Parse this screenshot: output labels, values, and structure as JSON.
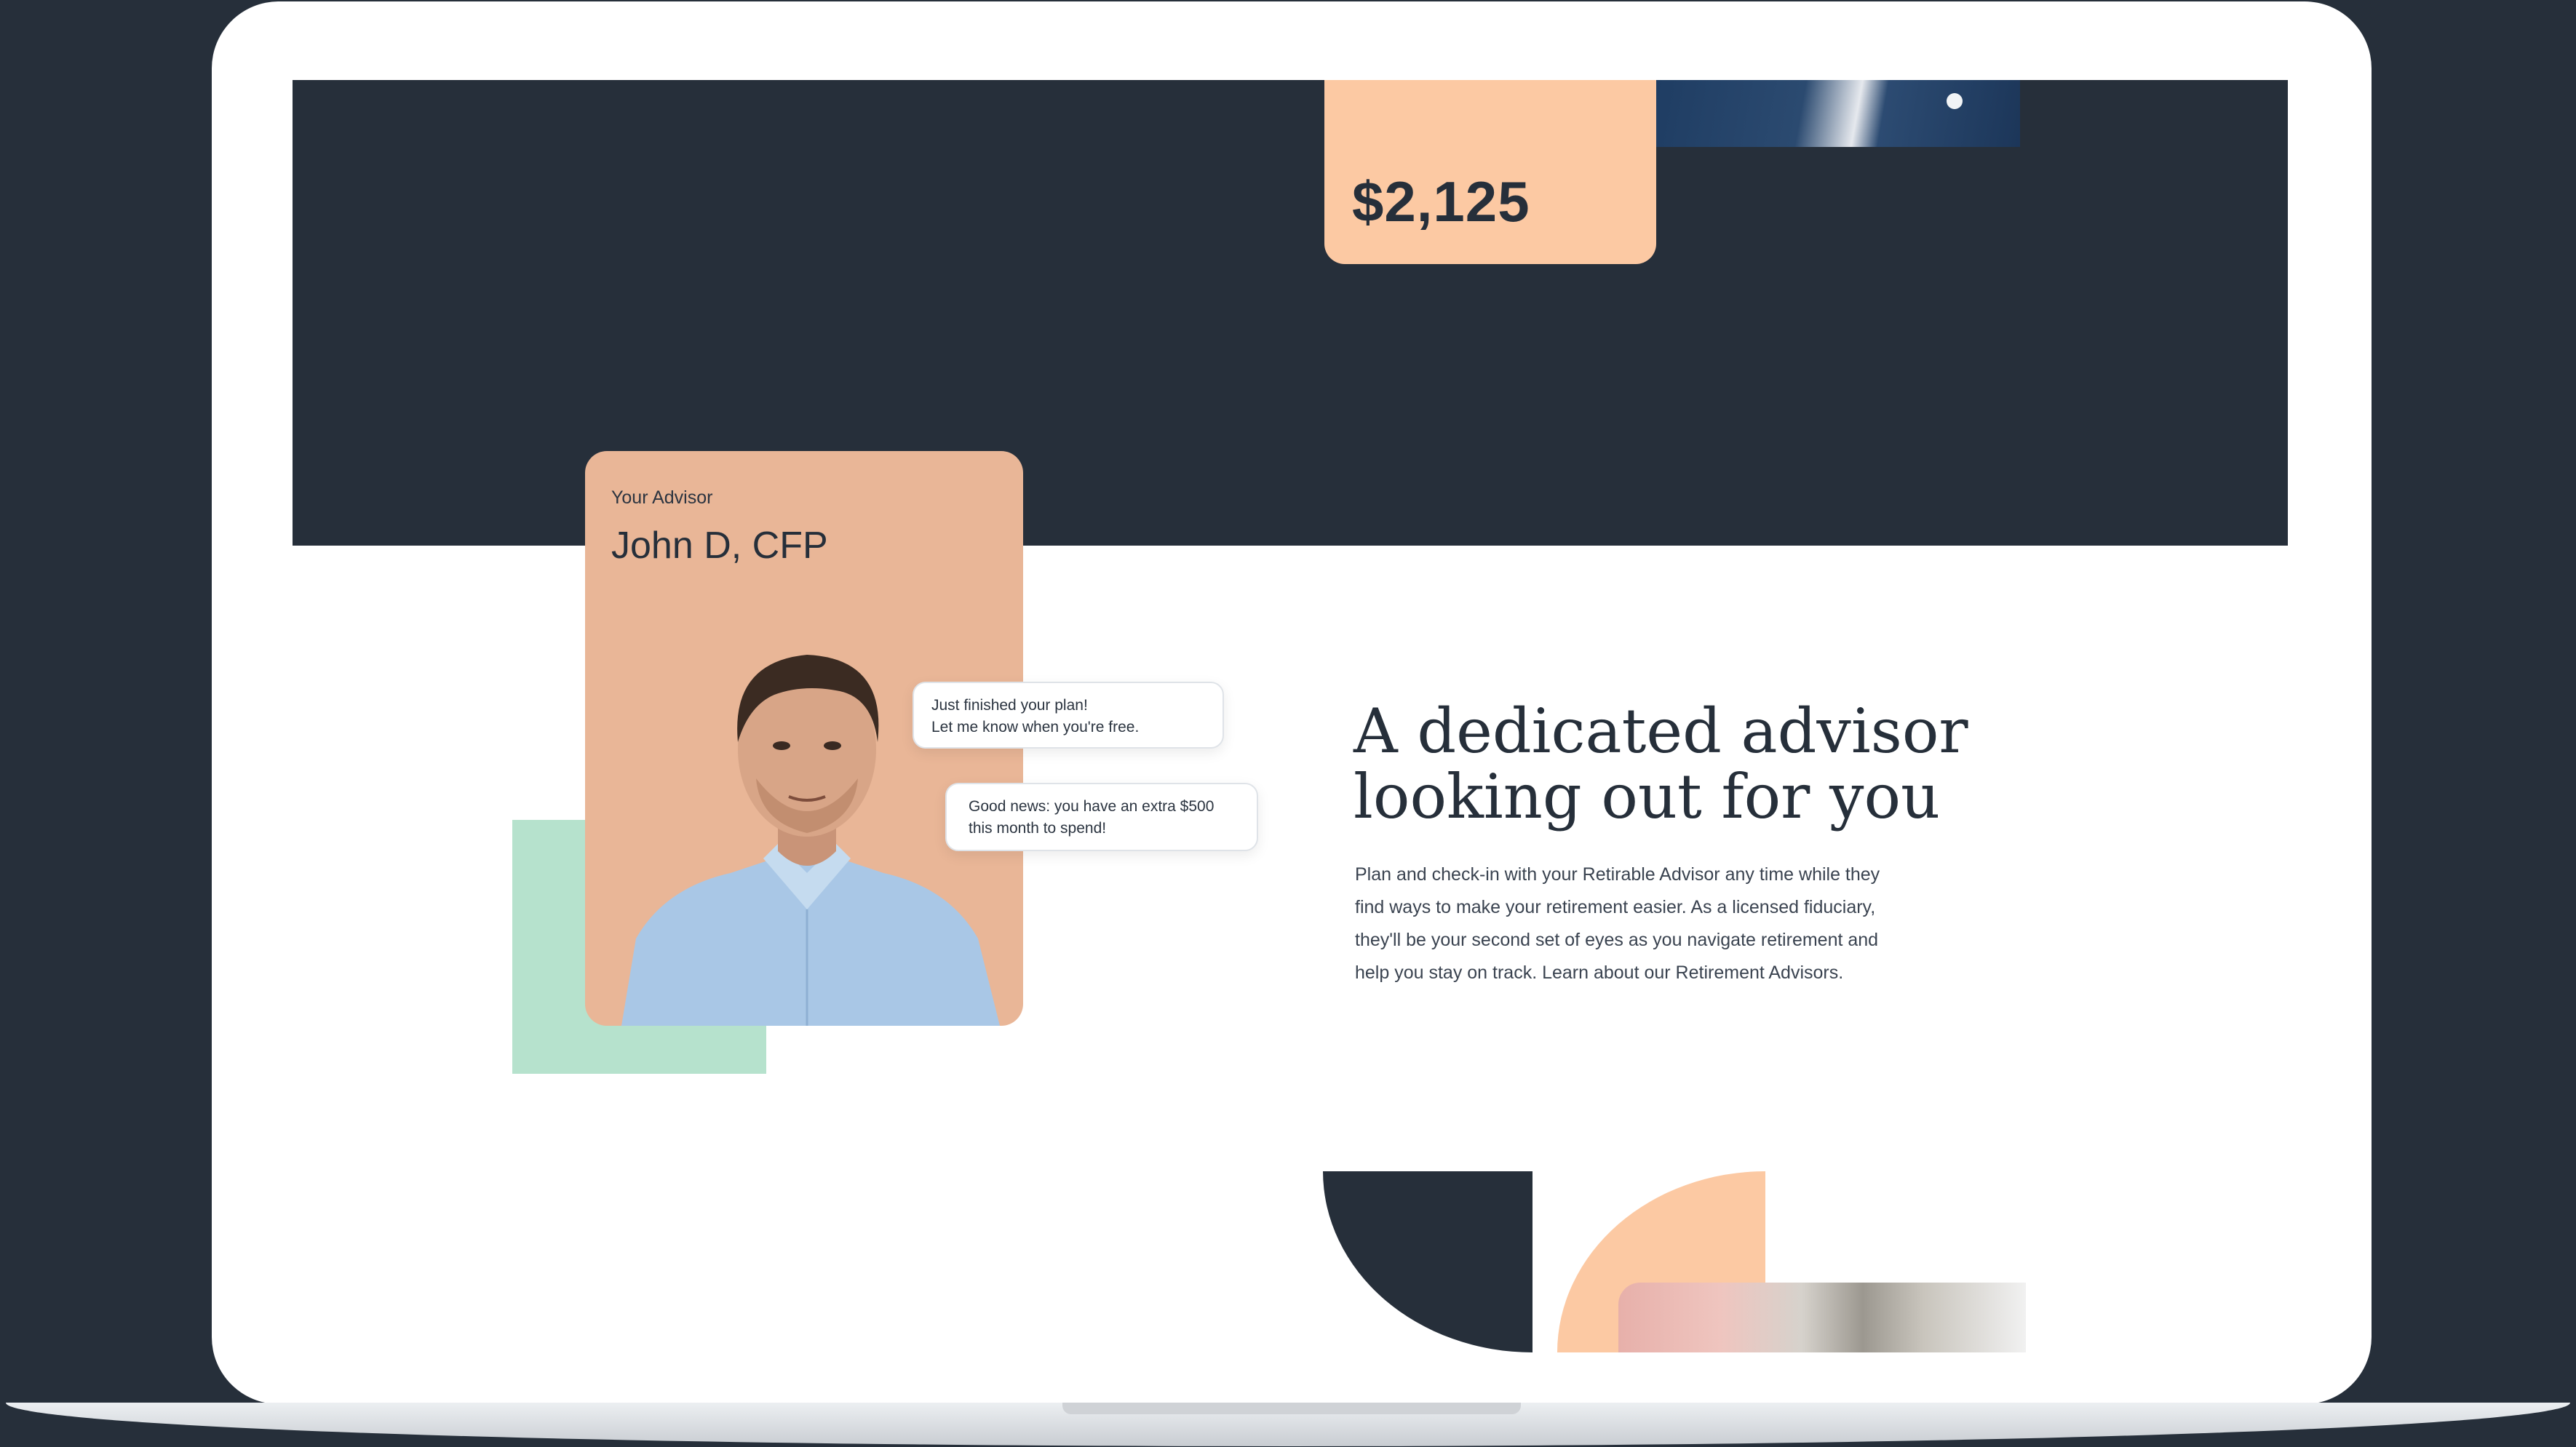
{
  "price_card": {
    "amount": "$2,125"
  },
  "advisor_card": {
    "label": "Your Advisor",
    "name": "John D, CFP"
  },
  "chat": [
    {
      "line1": "Just finished your plan!",
      "line2": "Let me know when you're free."
    },
    {
      "line1": "Good news: you have an extra $500",
      "line2": "this month to spend!"
    }
  ],
  "feature": {
    "headline_line1": "A dedicated advisor",
    "headline_line2": "looking out for you",
    "body": "Plan and check-in with your Retirable Advisor any time while they find ways to make your retirement easier. As a licensed fiduciary, they'll be your second set of eyes as you navigate retirement and help you stay on track. Learn about our Retirement Advisors."
  },
  "colors": {
    "navy": "#262f3a",
    "peach": "#fcc9a3",
    "terracotta": "#e9b697",
    "mint": "#b6e2cd",
    "white": "#ffffff"
  },
  "icons": [
    "person-photo",
    "jacket-photo",
    "portrait-photo"
  ]
}
